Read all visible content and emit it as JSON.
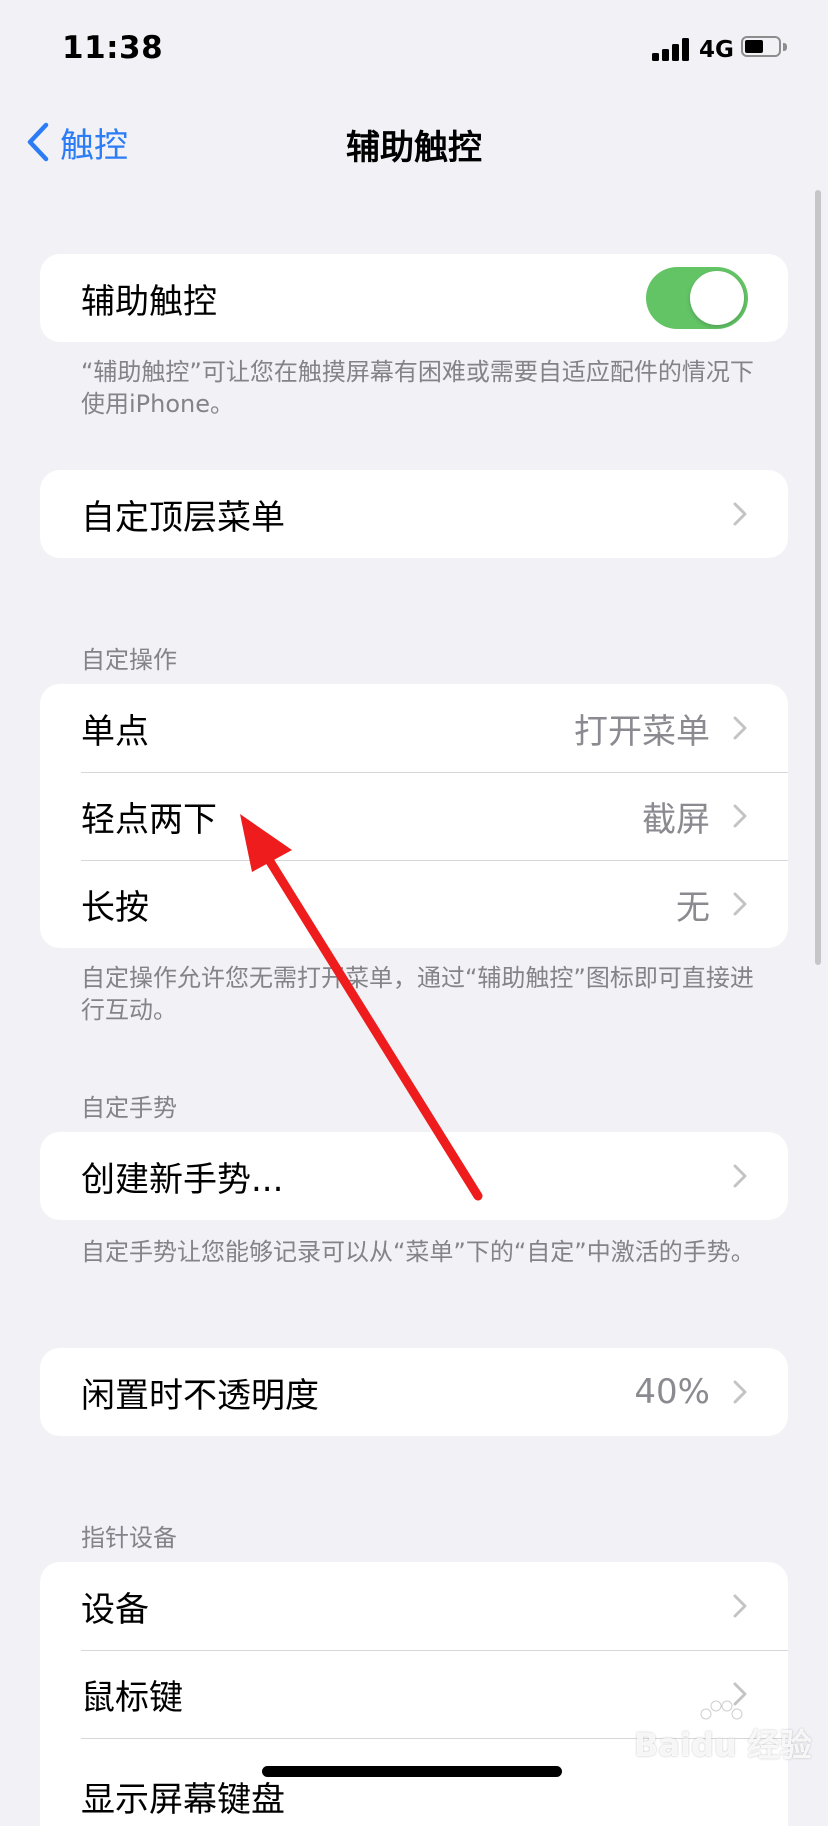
{
  "status_bar": {
    "time": "11:38",
    "network": "4G",
    "signal_bars": 4,
    "battery_level": 0.55
  },
  "nav": {
    "back_label": "触控",
    "title": "辅助触控"
  },
  "colors": {
    "accent": "#2b7cf5",
    "toggle_on": "#63c466",
    "background": "#f2f1f6",
    "secondary_text": "#8b8a90",
    "annotation_arrow": "#ee1c1c"
  },
  "main_toggle": {
    "label": "辅助触控",
    "on": true,
    "footer": "“辅助触控”可让您在触摸屏幕有困难或需要自适应配件的情况下使用iPhone。"
  },
  "top_menu": {
    "label": "自定顶层菜单"
  },
  "custom_actions": {
    "header": "自定操作",
    "items": [
      {
        "label": "单点",
        "value": "打开菜单"
      },
      {
        "label": "轻点两下",
        "value": "截屏"
      },
      {
        "label": "长按",
        "value": "无"
      }
    ],
    "footer": "自定操作允许您无需打开菜单，通过“辅助触控”图标即可直接进行互动。"
  },
  "custom_gestures": {
    "header": "自定手势",
    "create_label": "创建新手势...",
    "footer": "自定手势让您能够记录可以从“菜单”下的“自定”中激活的手势。"
  },
  "idle_opacity": {
    "label": "闲置时不透明度",
    "value": "40%"
  },
  "pointer_devices": {
    "header": "指针设备",
    "items": [
      {
        "label": "设备"
      },
      {
        "label": "鼠标键"
      },
      {
        "label": "显示屏幕键盘"
      }
    ]
  },
  "watermark": {
    "text": "Baidu 经验"
  }
}
